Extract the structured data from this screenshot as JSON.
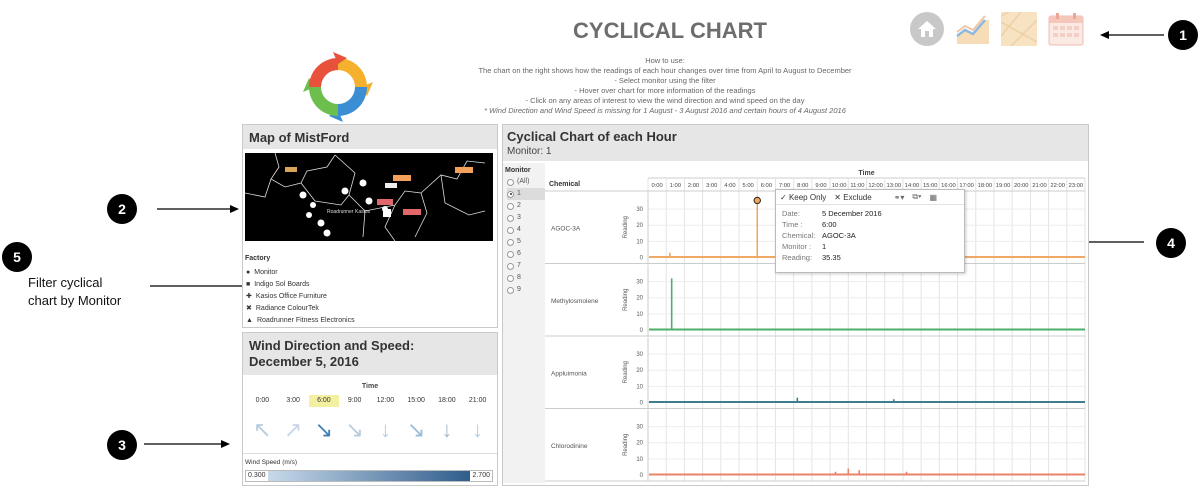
{
  "header": {
    "title": "CYCLICAL CHART",
    "howto": [
      "How to use:",
      "The chart on the right shows how the readings of each hour changes over time from April to August to December",
      "- Select monitor using the filter",
      "- Hover over chart for more information of the readings",
      "- Click on any areas of interest to view the wind direction and wind speed on the day"
    ],
    "note": "* Wind Direction and Wind Speed is missing for 1 August - 3 August 2016 and certain hours of 4 August 2016",
    "nav_icons": [
      "home-icon",
      "line-chart-icon",
      "map-icon",
      "calendar-icon"
    ]
  },
  "callouts": {
    "c1": "1",
    "c2": "2",
    "c3": "3",
    "c4": "4",
    "c5": "5",
    "c5_text_1": "Filter cyclical",
    "c5_text_2": "chart by Monitor"
  },
  "map_panel": {
    "title": "Map of MistFord",
    "factory_heading": "Factory",
    "factories": [
      {
        "symbol": "●",
        "label": "Monitor"
      },
      {
        "symbol": "■",
        "label": "Indigo Sol Boards"
      },
      {
        "symbol": "✚",
        "label": "Kasios Office Furniture"
      },
      {
        "symbol": "✖",
        "label": "Radiance ColourTek"
      },
      {
        "symbol": "▲",
        "label": "Roadrunner Fitness Electronics"
      }
    ]
  },
  "wind_panel": {
    "title_line1": "Wind Direction and Speed:",
    "title_line2": "December 5, 2016",
    "time_label": "Time",
    "times": [
      "0:00",
      "3:00",
      "6:00",
      "9:00",
      "12:00",
      "15:00",
      "18:00",
      "21:00"
    ],
    "highlighted_time": "6:00",
    "arrows": [
      "↖",
      "↗",
      "↘",
      "↘",
      "↓",
      "↘",
      "↓",
      "↓"
    ],
    "arrow_colors": [
      "#b6cde0",
      "#c8d7e6",
      "#3f7fb5",
      "#b6cde0",
      "#b6cde0",
      "#9cbcd8",
      "#a7b9c8",
      "#b6cde0"
    ],
    "speed_label": "Wind Speed (m/s)",
    "speed_min": "0.300",
    "speed_max": "2.700"
  },
  "chart_panel": {
    "title": "Cyclical Chart of each Hour",
    "subtitle": "Monitor: 1",
    "monitor_heading": "Monitor",
    "monitors": [
      "(All)",
      "1",
      "2",
      "3",
      "4",
      "5",
      "6",
      "7",
      "8",
      "9"
    ],
    "selected_monitor": "1",
    "chemical_heading": "Chemical",
    "time_heading": "Time",
    "y_axis_label": "Reading",
    "hours": [
      "0:00",
      "1:00",
      "2:00",
      "3:00",
      "4:00",
      "5:00",
      "6:00",
      "7:00",
      "8:00",
      "9:00",
      "10:00",
      "11:00",
      "12:00",
      "13:00",
      "14:00",
      "15:00",
      "16:00",
      "17:00",
      "18:00",
      "19:00",
      "20:00",
      "21:00",
      "22:00",
      "23:00"
    ]
  },
  "tooltip": {
    "keep_only": "Keep Only",
    "exclude": "Exclude",
    "rows": [
      {
        "key": "Date:",
        "value": "5 December 2016"
      },
      {
        "key": "Time :",
        "value": "6:00"
      },
      {
        "key": "Chemical:",
        "value": "AGOC-3A"
      },
      {
        "key": "Monitor :",
        "value": "1"
      },
      {
        "key": "Reading:",
        "value": "35.35"
      }
    ]
  },
  "chart_data": {
    "type": "line",
    "x_axis": "Time",
    "y_axis": "Reading",
    "ylim": [
      0,
      35
    ],
    "yticks": [
      0,
      10,
      20,
      30
    ],
    "series": [
      {
        "name": "AGOC-3A",
        "color": "#f0a868",
        "baseline": 0.3,
        "spikes": [
          {
            "hour": 1.2,
            "value": 3
          },
          {
            "hour": 6.0,
            "value": 35.35
          }
        ]
      },
      {
        "name": "Methylosmolene",
        "color": "#4caf6a",
        "baseline": 0.3,
        "spikes": [
          {
            "hour": 1.3,
            "value": 32
          }
        ]
      },
      {
        "name": "Appluimonia",
        "color": "#3d7d8f",
        "baseline": 0.3,
        "spikes": [
          {
            "hour": 8.2,
            "value": 3
          },
          {
            "hour": 13.5,
            "value": 2
          }
        ]
      },
      {
        "name": "Chlorodinine",
        "color": "#e8836a",
        "baseline": 0.3,
        "spikes": [
          {
            "hour": 11.0,
            "value": 4
          },
          {
            "hour": 11.6,
            "value": 3
          },
          {
            "hour": 10.3,
            "value": 2
          },
          {
            "hour": 14.2,
            "value": 2
          },
          {
            "hour": 2.5,
            "value": 1
          }
        ]
      }
    ]
  }
}
